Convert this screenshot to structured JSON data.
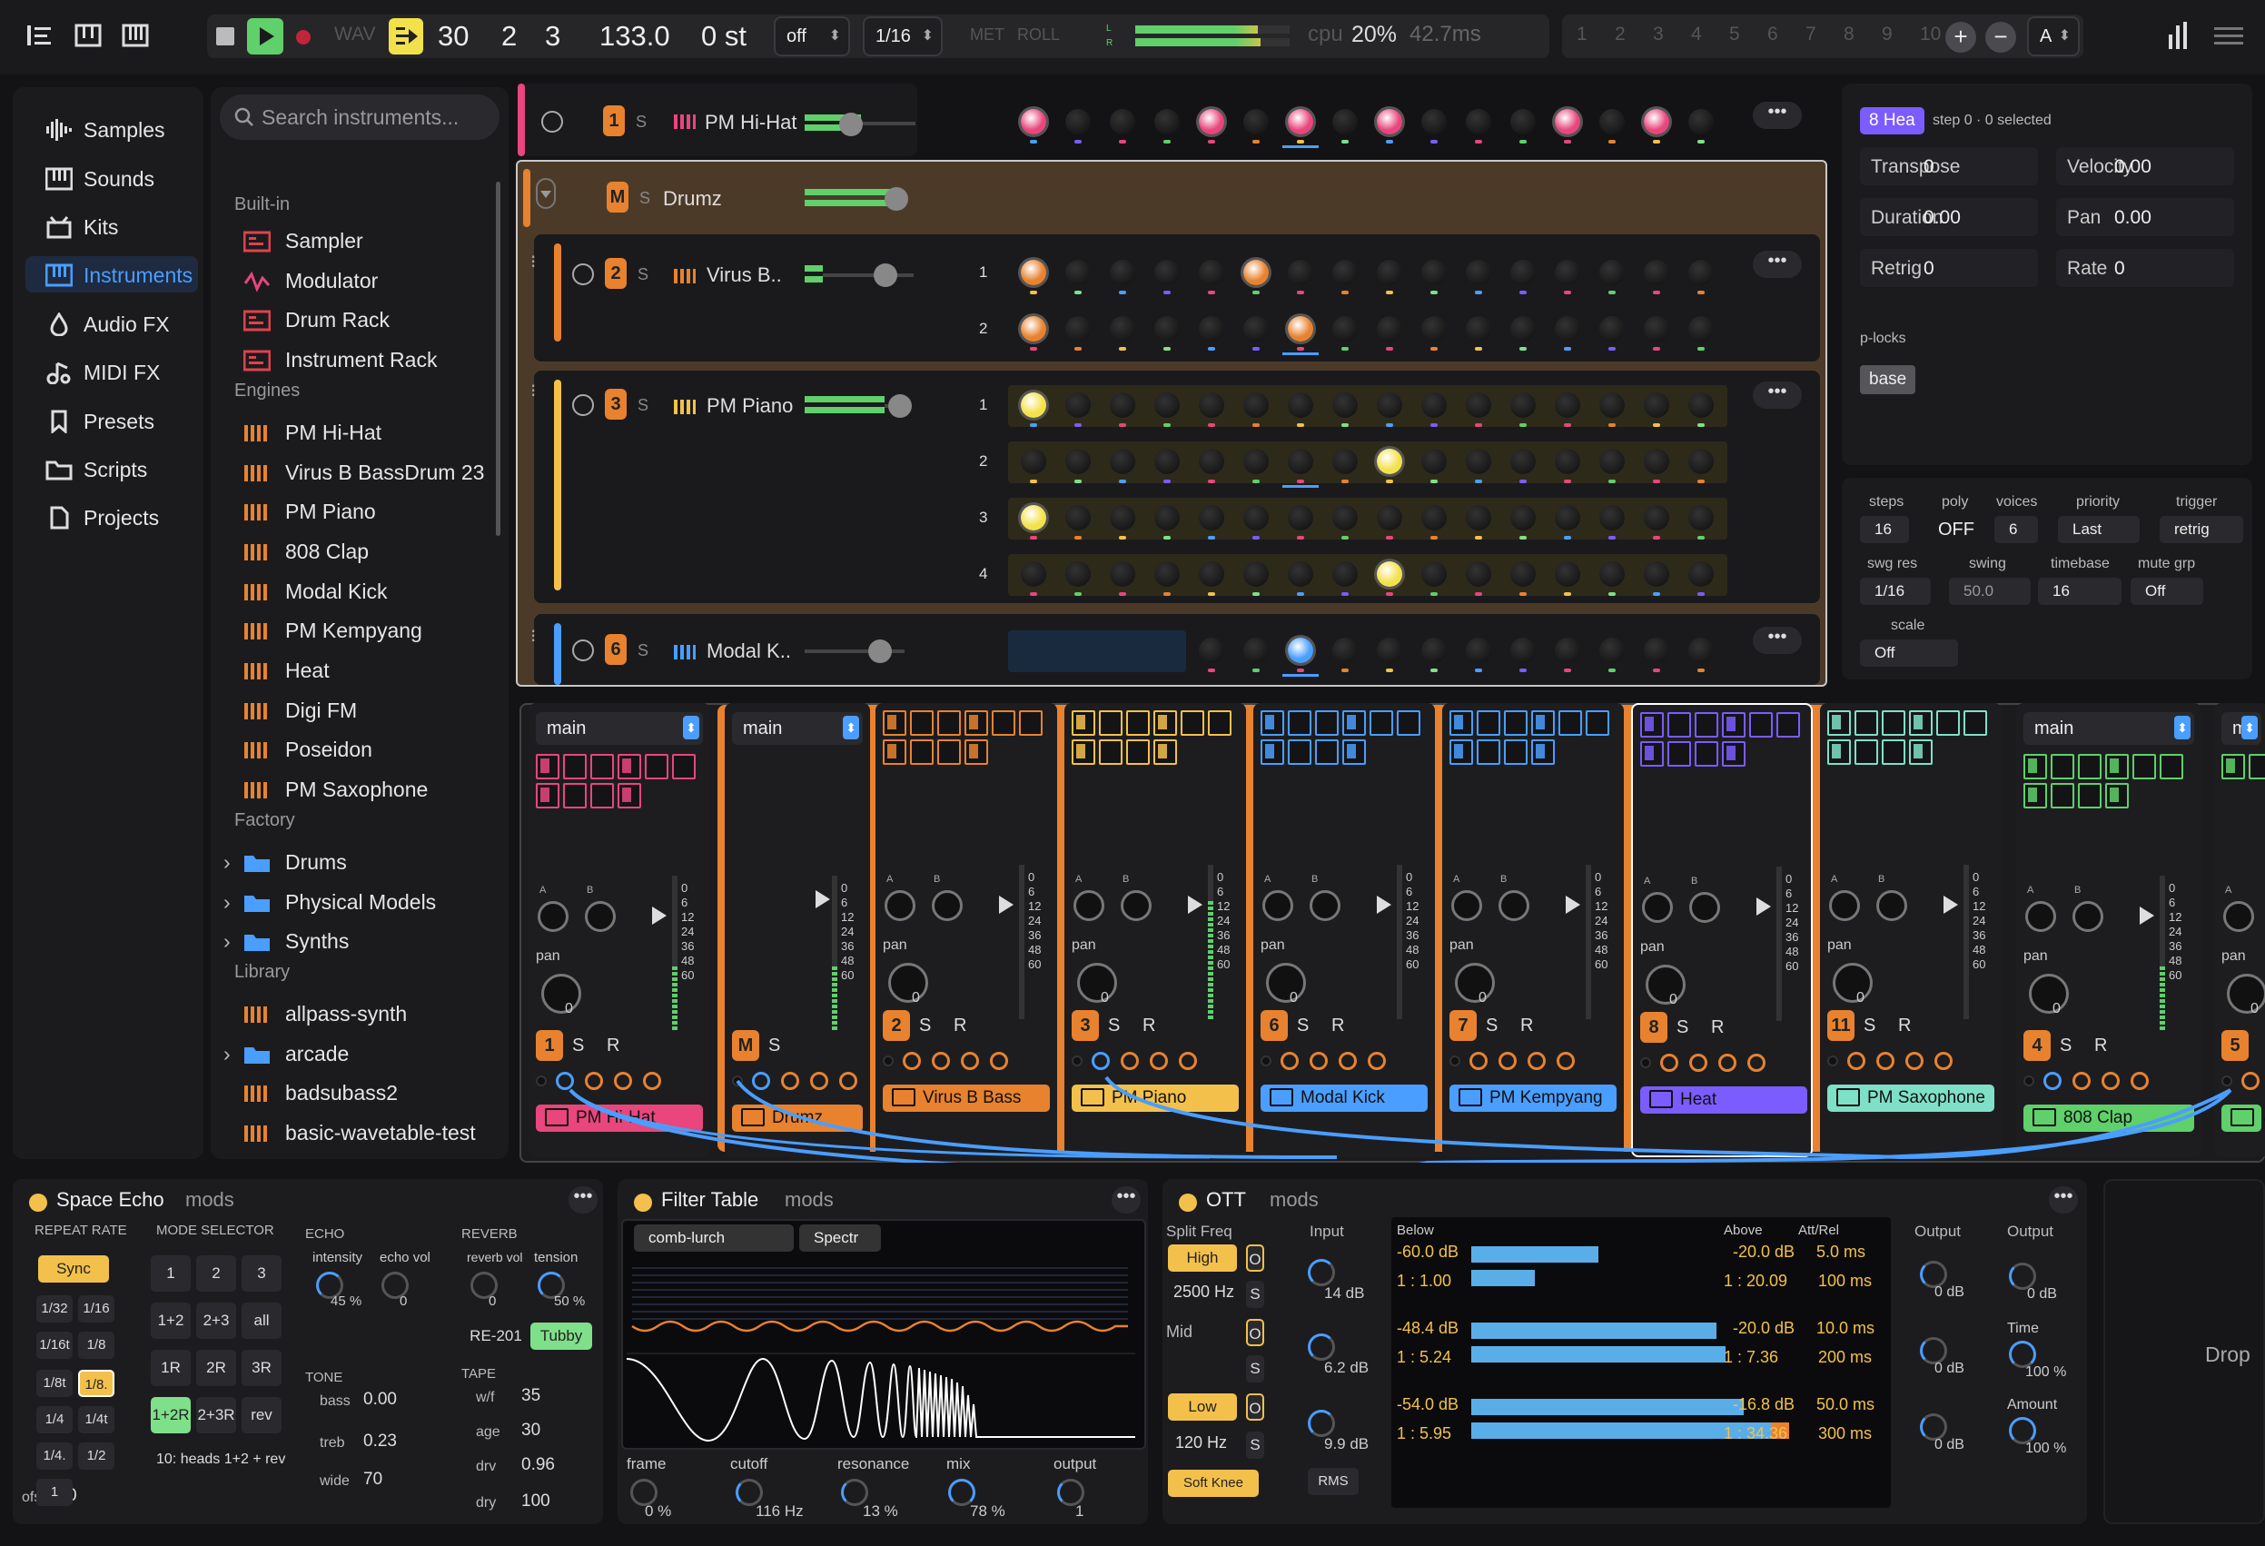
{
  "transport": {
    "wav": "WAV",
    "bars": "30",
    "beat": "2",
    "sub": "3",
    "bpm": "133.0",
    "transpose": "0 st",
    "sync_mode": "off",
    "quant": "1/16",
    "met": "MET",
    "roll": "ROLL",
    "lr_l": "L",
    "lr_r": "R",
    "cpu_label": "cpu",
    "cpu_pct": "20%",
    "latency": "42.7ms",
    "scene_nums": [
      "1",
      "2",
      "3",
      "4",
      "5",
      "6",
      "7",
      "8",
      "9",
      "10"
    ],
    "add": "+",
    "remove": "−",
    "scene_sel": "A"
  },
  "nav": {
    "items": [
      {
        "label": "Samples",
        "icon": "waveform-icon"
      },
      {
        "label": "Sounds",
        "icon": "piano-keys-icon"
      },
      {
        "label": "Kits",
        "icon": "drum-icon"
      },
      {
        "label": "Instruments",
        "icon": "instrument-icon"
      },
      {
        "label": "Audio FX",
        "icon": "droplet-icon"
      },
      {
        "label": "MIDI FX",
        "icon": "midi-note-icon"
      },
      {
        "label": "Presets",
        "icon": "bookmark-icon"
      },
      {
        "label": "Scripts",
        "icon": "folder-icon"
      },
      {
        "label": "Projects",
        "icon": "document-icon"
      }
    ],
    "active": "Instruments"
  },
  "browser": {
    "search_placeholder": "Search instruments...",
    "builtin_header": "Built-in",
    "builtin": [
      "Sampler",
      "Modulator",
      "Drum Rack",
      "Instrument Rack"
    ],
    "engines_header": "Engines",
    "engines": [
      "PM Hi-Hat",
      "Virus B BassDrum 23",
      "PM Piano",
      "808 Clap",
      "Modal Kick",
      "PM Kempyang",
      "Heat",
      "Digi FM",
      "Poseidon",
      "PM Saxophone"
    ],
    "factory_header": "Factory",
    "factory": [
      "Drums",
      "Physical Models",
      "Synths"
    ],
    "library_header": "Library",
    "library": [
      "allpass-synth",
      "arcade",
      "badsubass2",
      "basic-wavetable-test"
    ]
  },
  "tracks": {
    "hihat": {
      "num": "1",
      "s": "S",
      "name": "PM Hi-Hat"
    },
    "drumz": {
      "m": "M",
      "s": "S",
      "name": "Drumz"
    },
    "virus": {
      "num": "2",
      "s": "S",
      "name": "Virus B..",
      "rows": [
        "1",
        "2"
      ]
    },
    "piano": {
      "num": "3",
      "s": "S",
      "name": "PM Piano",
      "rows": [
        "1",
        "2",
        "3",
        "4"
      ]
    },
    "modal": {
      "num": "6",
      "s": "S",
      "name": "Modal K.."
    },
    "menu": "•••"
  },
  "inspector": {
    "badge": "8 Hea",
    "status": "step 0 · 0 selected",
    "fields": [
      {
        "label": "Transpose",
        "value": "0"
      },
      {
        "label": "Velocity",
        "value": "0.00"
      },
      {
        "label": "Duration",
        "value": "0.00"
      },
      {
        "label": "Pan",
        "value": "0.00"
      },
      {
        "label": "Retrig",
        "value": "0"
      },
      {
        "label": "Rate",
        "value": "0"
      }
    ],
    "plocks_label": "p-locks",
    "plocks_chip": "base"
  },
  "params": {
    "steps_l": "steps",
    "steps": "16",
    "poly_l": "poly",
    "poly": "OFF",
    "voices_l": "voices",
    "voices": "6",
    "priority_l": "priority",
    "priority": "Last",
    "trigger_l": "trigger",
    "trigger": "retrig",
    "swgres_l": "swg res",
    "swgres": "1/16",
    "swing_l": "swing",
    "swing": "50.0",
    "timebase_l": "timebase",
    "timebase": "16",
    "mutegrp_l": "mute grp",
    "mutegrp": "Off",
    "scale_l": "scale",
    "scale": "Off"
  },
  "mixer": {
    "strips": [
      {
        "head": "main",
        "num": "1",
        "s": "S",
        "r": "R",
        "label": "PM Hi-Hat",
        "color": "#e8467c"
      },
      {
        "head": "main",
        "m": "M",
        "s": "S",
        "label": "Drumz",
        "color": "#e8822f"
      },
      {
        "num": "2",
        "s": "S",
        "r": "R",
        "label": "Virus B Bass",
        "color": "#e8822f"
      },
      {
        "num": "3",
        "s": "S",
        "r": "R",
        "label": "PM Piano",
        "color": "#f3c14b"
      },
      {
        "num": "6",
        "s": "S",
        "r": "R",
        "label": "Modal Kick",
        "color": "#4a9eff"
      },
      {
        "num": "7",
        "s": "S",
        "r": "R",
        "label": "PM Kempyang",
        "color": "#4a9eff"
      },
      {
        "num": "8",
        "s": "S",
        "r": "R",
        "label": "Heat",
        "color": "#7a5cff"
      },
      {
        "num": "11",
        "s": "S",
        "r": "R",
        "label": "PM Saxophone",
        "color": "#7fe0c8"
      },
      {
        "head": "main",
        "num": "4",
        "s": "S",
        "r": "R",
        "label": "808 Clap",
        "color": "#5fd06a"
      },
      {
        "head": "ma",
        "num": "5",
        "label": "✓",
        "color": "#5fd06a"
      }
    ],
    "meter_scale": [
      "0",
      "6",
      "12",
      "24",
      "36",
      "48",
      "60"
    ],
    "pan": "pan",
    "a": "A",
    "b": "B",
    "pan_value": "0"
  },
  "fx_echo": {
    "title": "Space Echo",
    "mods": "mods",
    "repeat_rate": "REPEAT RATE",
    "sync": "Sync",
    "rates": [
      "1/32",
      "1/16",
      "1/16t",
      "1/8",
      "1/8t",
      "1/8.",
      "1/4",
      "1/4t",
      "1/4.",
      "1/2",
      "1"
    ],
    "ofs_l": "ofs",
    "ofs": "0",
    "mode_selector": "MODE SELECTOR",
    "modes": [
      "1",
      "2",
      "3",
      "1+2",
      "2+3",
      "all",
      "1R",
      "2R",
      "3R",
      "1+2R",
      "2+3R",
      "rev"
    ],
    "mode_desc": "10: heads 1+2 + rev",
    "echo": "ECHO",
    "intensity": "intensity",
    "intensity_v": "45 %",
    "echo_vol": "echo vol",
    "echo_vol_v": "0",
    "reverb": "REVERB",
    "reverb_vol": "reverb vol",
    "reverb_vol_v": "0",
    "tension": "tension",
    "tension_v": "50 %",
    "re201": "RE-201",
    "tubby": "Tubby",
    "tone": "TONE",
    "bass_l": "bass",
    "bass": "0.00",
    "treb_l": "treb",
    "treb": "0.23",
    "wide_l": "wide",
    "wide": "70",
    "tape": "TAPE",
    "wf_l": "w/f",
    "wf": "35",
    "age_l": "age",
    "age": "30",
    "drv_l": "drv",
    "drv": "0.96",
    "dry_l": "dry",
    "dry": "100"
  },
  "fx_filter": {
    "title": "Filter Table",
    "mods": "mods",
    "preset": "comb-lurch",
    "mode": "Spectr",
    "frame": "frame",
    "frame_v": "0 %",
    "cutoff": "cutoff",
    "cutoff_v": "116 Hz",
    "resonance": "resonance",
    "resonance_v": "13 %",
    "mix": "mix",
    "mix_v": "78 %",
    "output": "output",
    "output_v": "1"
  },
  "fx_ott": {
    "title": "OTT",
    "mods": "mods",
    "split_freq": "Split Freq",
    "high": "High",
    "high_hz": "2500 Hz",
    "mid": "Mid",
    "low": "Low",
    "low_hz": "120 Hz",
    "soft_knee": "Soft Knee",
    "o": "O",
    "s": "S",
    "input": "Input",
    "in1": "14 dB",
    "in2": "6.2 dB",
    "in3": "9.9 dB",
    "rms": "RMS",
    "below": "Below",
    "above": "Above",
    "attrel": "Att/Rel",
    "b_db": [
      "-60.0 dB",
      "-48.4 dB",
      "-54.0 dB"
    ],
    "b_ratio": [
      "1 : 1.00",
      "1 : 5.24",
      "1 : 5.95"
    ],
    "a_db": [
      "-20.0 dB",
      "-20.0 dB",
      "-16.8 dB"
    ],
    "a_ratio": [
      "1 : 20.09",
      "1 : 7.36",
      "1 : 34.36"
    ],
    "att": [
      "5.0 ms",
      "10.0 ms",
      "50.0 ms"
    ],
    "rel": [
      "100 ms",
      "200 ms",
      "300 ms"
    ],
    "output": "Output",
    "out_db": [
      "0 dB",
      "0 dB",
      "0 dB"
    ],
    "output2": "Output",
    "out2": "0 dB",
    "time": "Time",
    "time_v": "100 %",
    "amount": "Amount",
    "amount_v": "100 %"
  },
  "drop": "Drop"
}
